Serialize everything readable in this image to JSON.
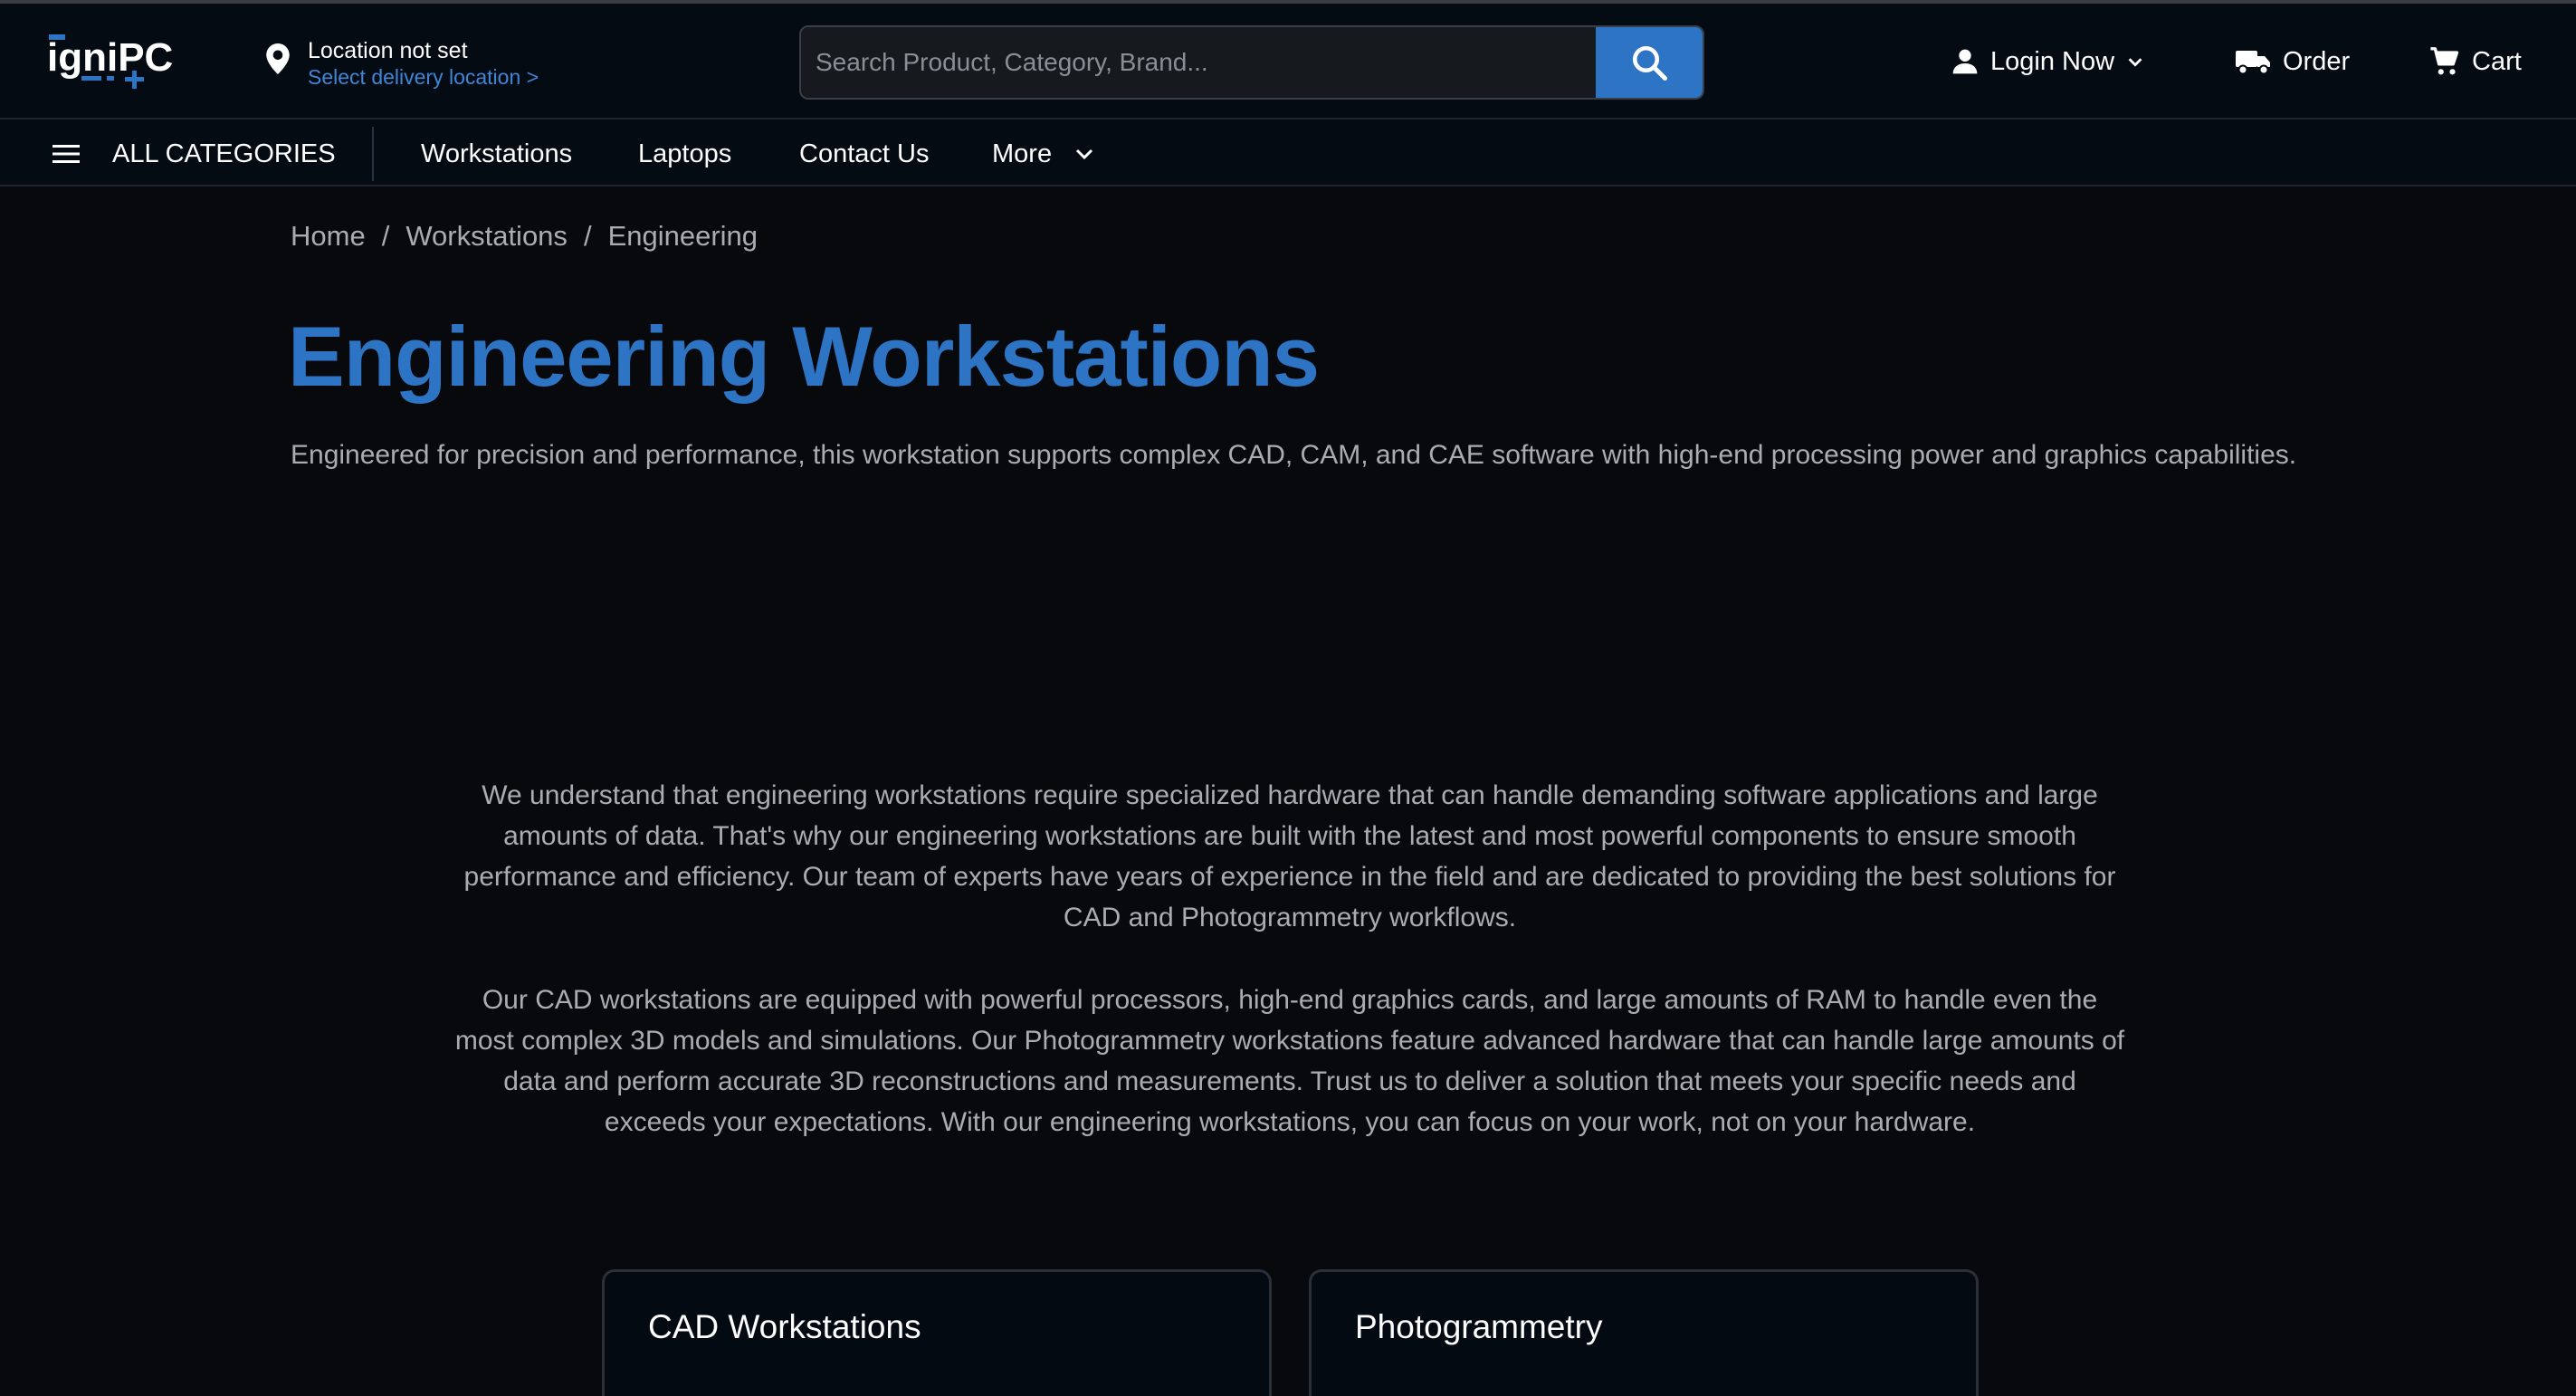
{
  "header": {
    "logo_text": "igniPC",
    "location": {
      "title": "Location not set",
      "subtitle": "Select delivery location >"
    },
    "search": {
      "placeholder": "Search Product, Category, Brand...",
      "value": ""
    },
    "actions": {
      "login": "Login Now",
      "order": "Order",
      "cart": "Cart"
    }
  },
  "nav": {
    "all_categories": "ALL CATEGORIES",
    "items": [
      "Workstations",
      "Laptops",
      "Contact Us",
      "More"
    ]
  },
  "breadcrumb": [
    "Home",
    "Workstations",
    "Engineering"
  ],
  "page": {
    "title": "Engineering Workstations",
    "subtitle": "Engineered for precision and performance, this workstation supports complex CAD, CAM, and CAE software with high-end processing power and graphics capabilities.",
    "intro": [
      "We understand that engineering workstations require specialized hardware that can handle demanding software applications and large amounts of data. That's why our engineering workstations are built with the latest and most powerful components to ensure smooth performance and efficiency. Our team of experts have years of experience in the field and are dedicated to providing the best solutions for CAD and Photogrammetry workflows.",
      "Our CAD workstations are equipped with powerful processors, high-end graphics cards, and large amounts of RAM to handle even the most complex 3D models and simulations. Our Photogrammetry workstations feature advanced hardware that can handle large amounts of data and perform accurate 3D reconstructions and measurements. Trust us to deliver a solution that meets your specific needs and exceeds your expectations. With our engineering workstations, you can focus on your work, not on your hardware."
    ],
    "cards": [
      "CAD Workstations",
      "Photogrammetry"
    ]
  },
  "colors": {
    "accent": "#2d74c4",
    "background": "#07090c",
    "header_bg": "#050b13",
    "muted_text": "#a9adb3"
  },
  "icons": [
    "location-pin-icon",
    "search-icon",
    "user-icon",
    "chevron-down-icon",
    "truck-icon",
    "cart-icon",
    "hamburger-menu-icon"
  ]
}
